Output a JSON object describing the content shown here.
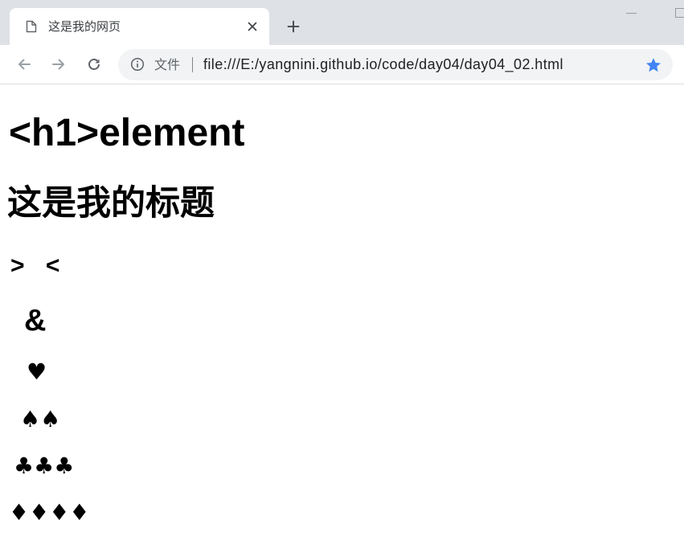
{
  "browser": {
    "tab": {
      "title": "这是我的网页",
      "icon": "page-icon",
      "close_icon": "close-icon"
    },
    "new_tab_icon": "plus-icon",
    "window_controls": {
      "minimize_icon": "minimize-icon",
      "maximize_icon": "maximize-icon"
    },
    "toolbar": {
      "back_icon": "back-arrow-icon",
      "forward_icon": "forward-arrow-icon",
      "reload_icon": "reload-icon"
    },
    "omnibox": {
      "security_icon": "info-icon",
      "scheme_label": "文件",
      "url": "file:///E:/yangnini.github.io/code/day04/day04_02.html",
      "bookmark_icon": "star-icon",
      "bookmarked": true
    }
  },
  "page": {
    "heading": "<h1>element",
    "title": "这是我的标题",
    "entities": {
      "gt_lt": "> <",
      "amp": "&",
      "hearts": "♥",
      "spades": "♠♠",
      "clubs": "♣♣♣",
      "diamonds": "♦♦♦♦"
    }
  },
  "colors": {
    "tab_strip": "#dee1e6",
    "omnibox": "#f1f3f4",
    "bookmark_star": "#4285f4",
    "text": "#202124",
    "icon": "#5f6368"
  }
}
